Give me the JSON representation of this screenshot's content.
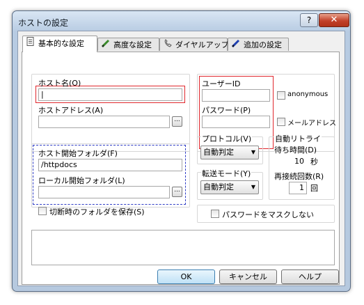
{
  "window": {
    "title": "ホストの設定",
    "help": "?",
    "close": "✕"
  },
  "tabs": [
    {
      "label": "基本的な設定",
      "icon": "page-icon"
    },
    {
      "label": "高度な設定",
      "icon": "pencil-icon"
    },
    {
      "label": "ダイヤルアップ",
      "icon": "phone-icon"
    },
    {
      "label": "追加の設定",
      "icon": "blue-pen-icon"
    }
  ],
  "host": {
    "name_label": "ホスト名(O)",
    "name_value": "|",
    "address_label": "ホストアドレス(A)",
    "address_value": "",
    "browse": "..."
  },
  "auth": {
    "user_label": "ユーザーID",
    "user_value": "",
    "password_label": "パスワード(P)",
    "password_value": "",
    "anonymous_label": "anonymous",
    "mail_label": "メールアドレス"
  },
  "folders": {
    "host_folder_label": "ホスト開始フォルダ(F)",
    "host_folder_value": "/httpdocs",
    "local_folder_label": "ローカル開始フォルダ(L)",
    "local_folder_value": "",
    "save_on_disconnect_label": "切断時のフォルダを保存(S)"
  },
  "protocol": {
    "label": "プロトコル(V)",
    "value": "自動判定"
  },
  "transfer": {
    "label": "転送モード(Y)",
    "value": "自動判定"
  },
  "retry": {
    "label": "自動リトライ",
    "wait_label": "待ち時間(D)",
    "wait_value": "10",
    "wait_unit": "秒",
    "count_label": "再接続回数(R)",
    "count_value": "1",
    "count_unit": "回"
  },
  "mask_password_label": "パスワードをマスクしない",
  "buttons": {
    "ok": "OK",
    "cancel": "キャンセル",
    "help": "ヘルプ"
  }
}
